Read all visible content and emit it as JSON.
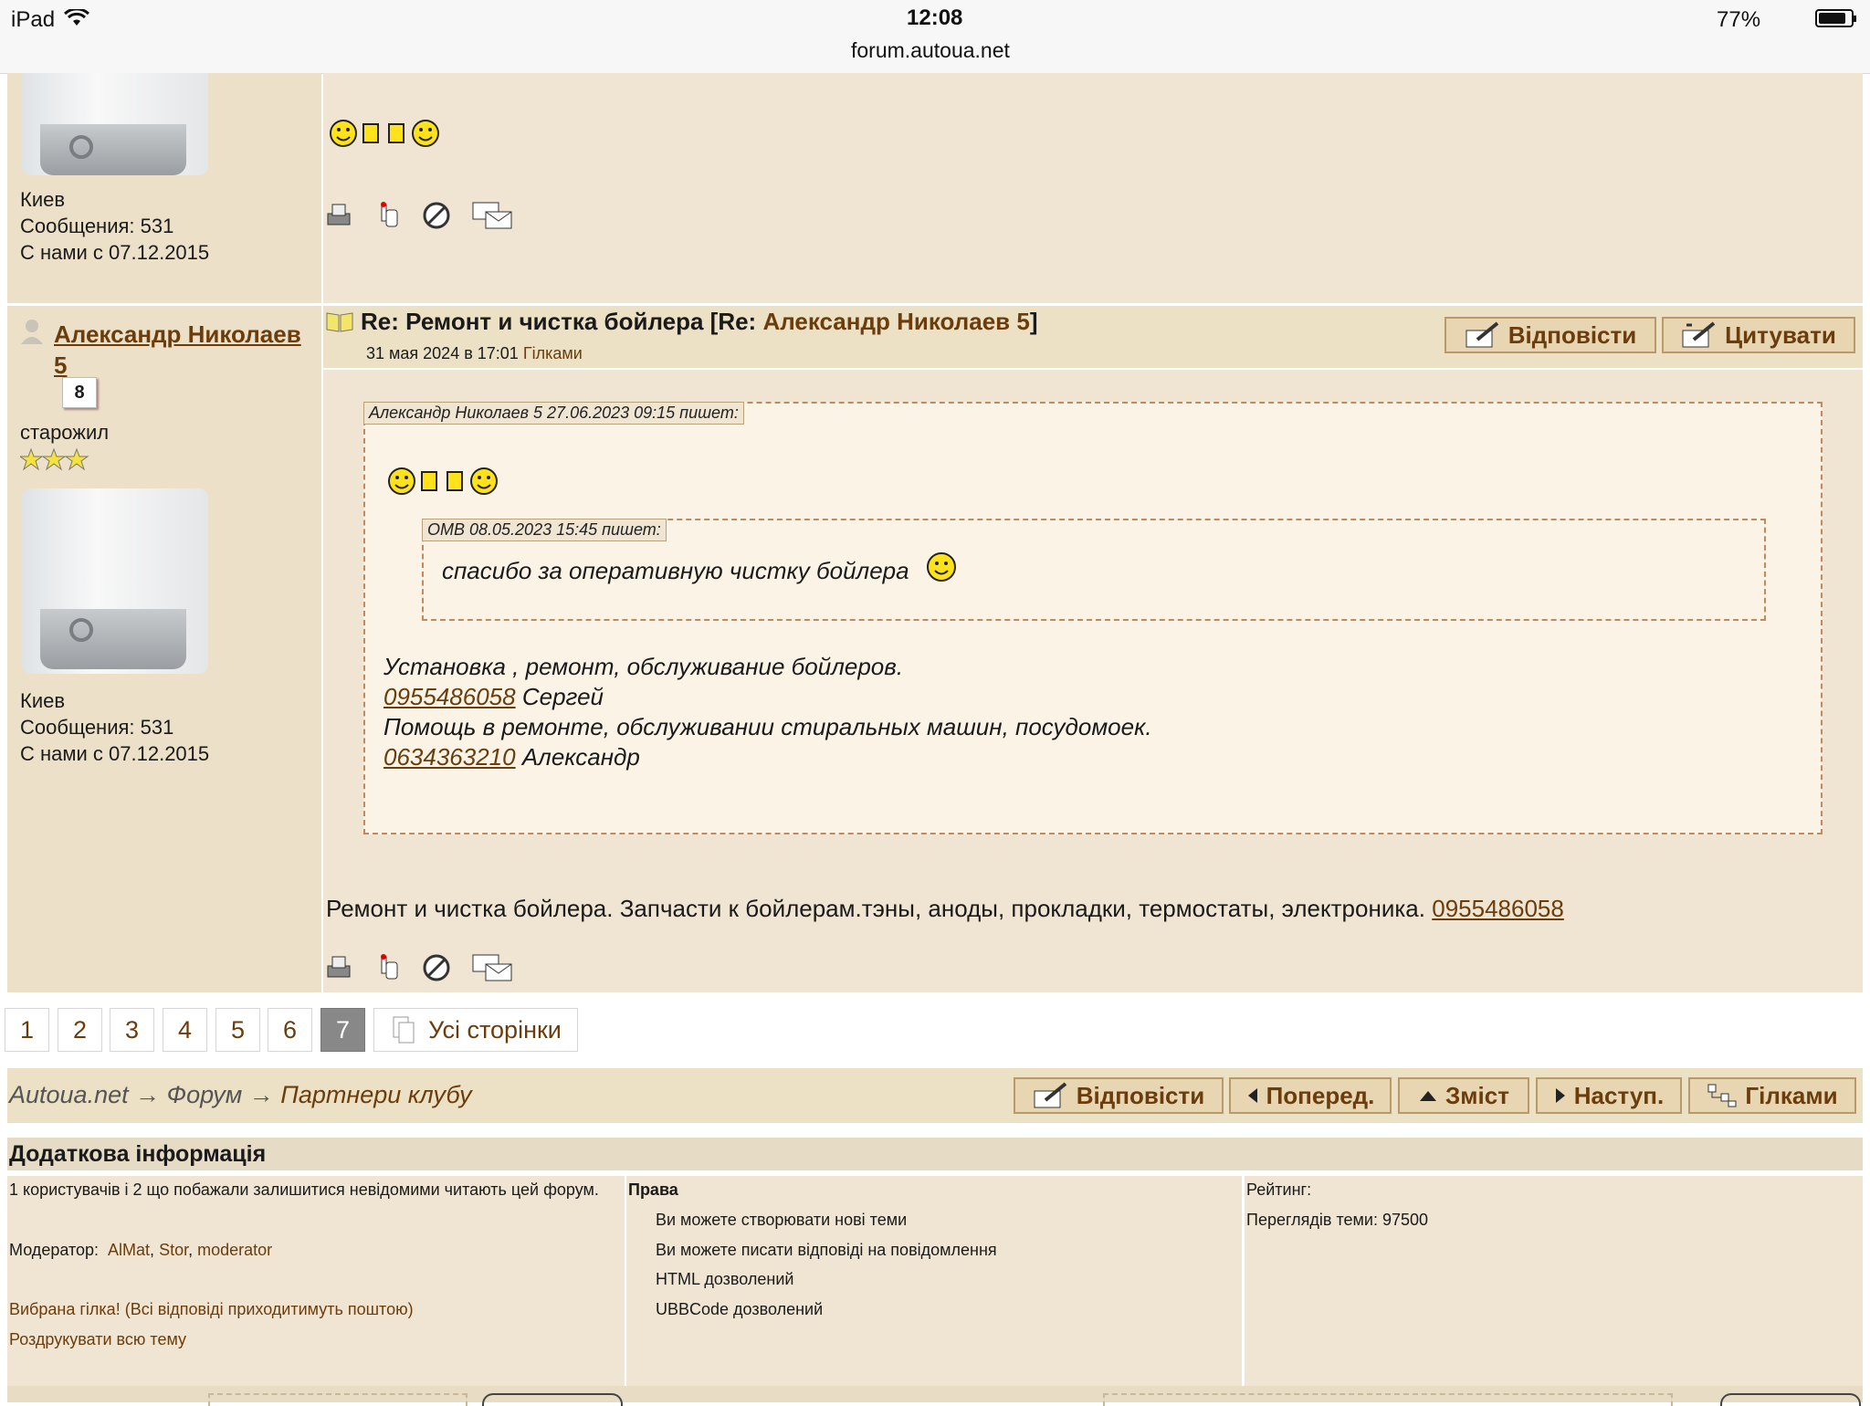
{
  "status_bar": {
    "device": "iPad",
    "time": "12:08",
    "url": "forum.autoua.net",
    "battery": "77%"
  },
  "prev_post": {
    "city": "Киев",
    "messages": "Сообщения: 531",
    "since": "С нами с 07.12.2015"
  },
  "post": {
    "author": "Александр Николаев 5",
    "author_line1": "Александр Николаев",
    "author_line2": "5",
    "rank_badge": "8",
    "status": "старожил",
    "city": "Киев",
    "messages": "Сообщения: 531",
    "since": "С нами с 07.12.2015",
    "title_prefix": "Re: Ремонт и чистка бойлера [Re: ",
    "title_author": "Александр Николаев 5",
    "title_suffix": "]",
    "date": "31 мая 2024 в 17:01",
    "branches_link": "Гілками",
    "reply_button": "Відповісти",
    "quote_button": "Цитувати",
    "quote1_header": "Александр Николаев 5 27.06.2023 09:15 пишет:",
    "quote2_header": "ОМВ 08.05.2023 15:45 пишет:",
    "quote2_text": "спасибо за оперативную чистку бойлера",
    "q_line1": "Установка , ремонт, обслуживание бойлеров.",
    "q_phone1": "0955486058",
    "q_name1": "Сергей",
    "q_line3": "Помощь в ремонте, обслуживании стиральных машин, посудомоек.",
    "q_phone2": "0634363210",
    "q_name2": "Александр",
    "signature_text": "Ремонт и чистка бойлера. Запчасти к бойлерам.тэны, аноды, прокладки, термостаты, электроника.",
    "signature_phone": "0955486058"
  },
  "pagination": {
    "pages": [
      "1",
      "2",
      "3",
      "4",
      "5",
      "6",
      "7"
    ],
    "current": "7",
    "all_pages": "Усі сторінки"
  },
  "breadcrumb": {
    "site": "Autoua.net",
    "arrow": "→",
    "forum": "Форум",
    "section": "Партнери клубу"
  },
  "nav_buttons": {
    "reply": "Відповісти",
    "prev": "Поперед.",
    "contents": "Зміст",
    "next": "Наступ.",
    "branches": "Гілками"
  },
  "info": {
    "heading": "Додаткова інформація",
    "readers": "1 користувачів і 2 що побажали залишитися невідомими читають цей форум.",
    "moderator_label": "Модератор:",
    "moderators": [
      "AlMat",
      "Stor",
      "moderator"
    ],
    "favorite": "Вибрана гілка! (Всі відповіді приходитимуть поштою)",
    "print_all": "Роздрукувати всю тему",
    "rights_heading": "Права",
    "rights": [
      "Ви можете створювати нові теми",
      "Ви можете писати відповіді на повідомлення",
      "HTML дозволений",
      "UBBCode дозволений"
    ],
    "rating_label": "Рейтинг:",
    "views": "Переглядів теми: 97500"
  },
  "colors": {
    "accent": "#6b3d0c",
    "panel": "#efe5d2",
    "sidebar": "#ede0c8",
    "quote_bg": "#fbf4e6",
    "quote_border": "#c08a5e"
  }
}
